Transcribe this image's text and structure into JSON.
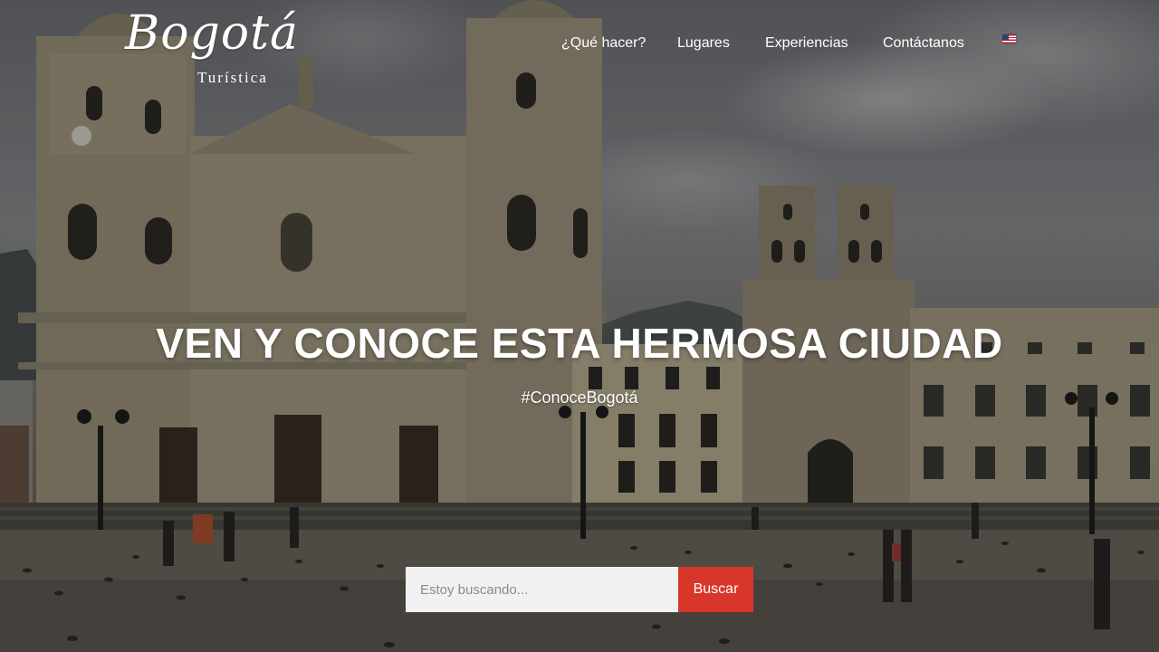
{
  "brand": {
    "name": "Bogotá",
    "subtitle": "Turística"
  },
  "nav": {
    "items": [
      {
        "label": "¿Qué hacer?"
      },
      {
        "label": "Lugares"
      },
      {
        "label": "Experiencias"
      },
      {
        "label": "Contáctanos"
      }
    ],
    "language_icon": "us-flag-icon"
  },
  "hero": {
    "headline": "VEN Y CONOCE ESTA HERMOSA CIUDAD",
    "hashtag": "#ConoceBogotá"
  },
  "search": {
    "placeholder": "Estoy buscando...",
    "value": "",
    "button_label": "Buscar"
  },
  "colors": {
    "accent": "#d9362b",
    "text": "#ffffff",
    "input_bg": "#f1f1f1"
  }
}
